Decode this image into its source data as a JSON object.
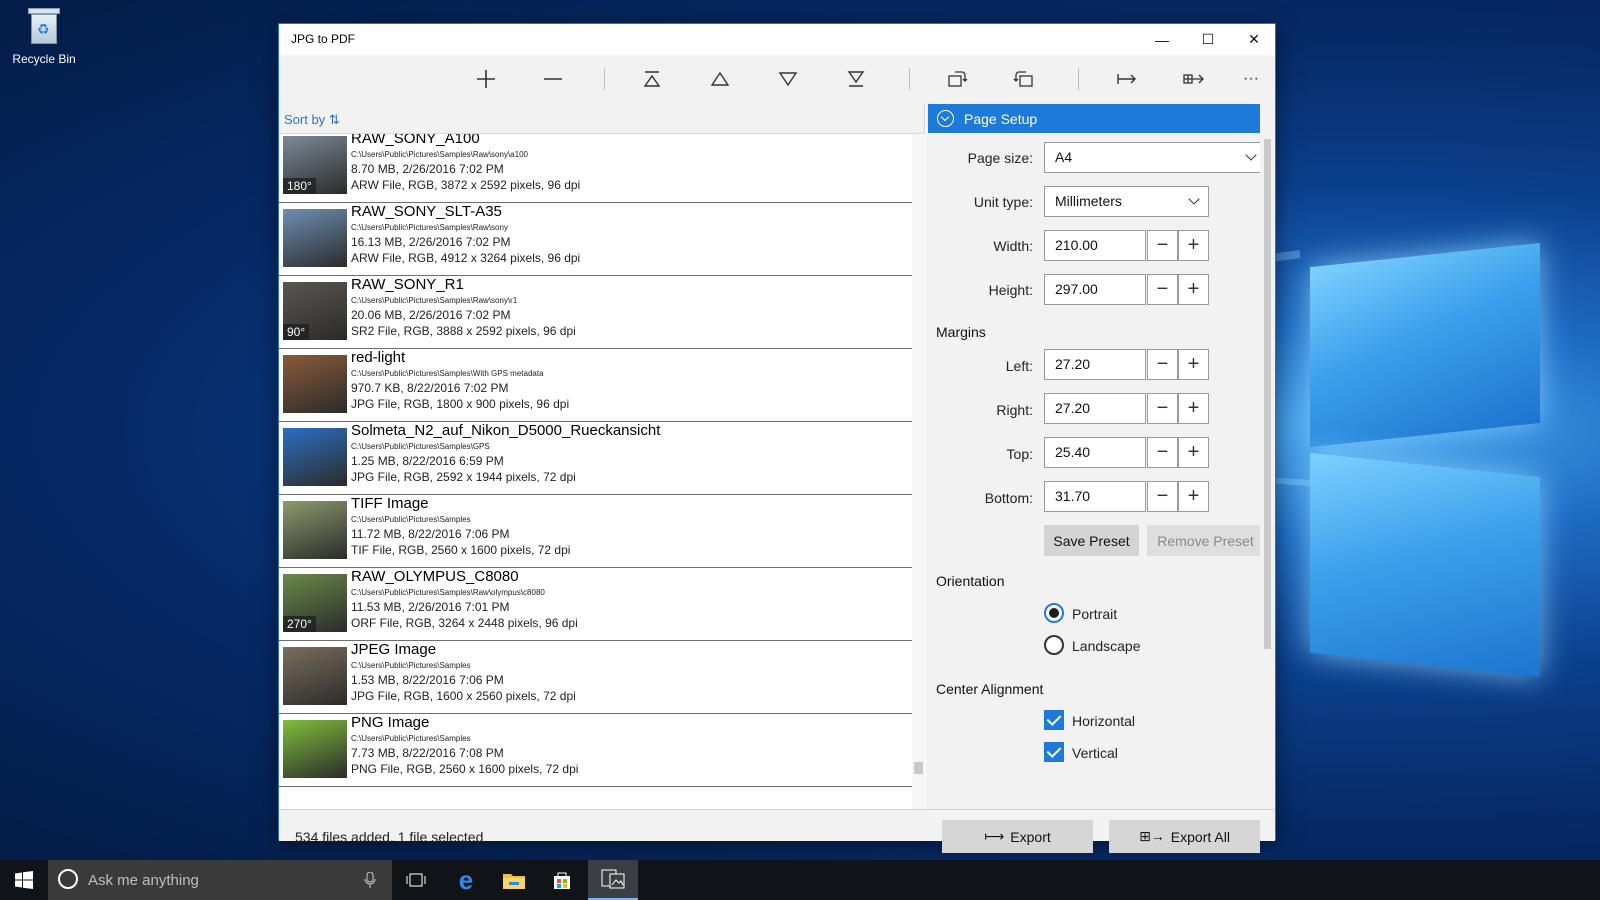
{
  "desktop": {
    "recycle_bin_label": "Recycle Bin"
  },
  "window": {
    "title": "JPG to PDF",
    "controls": {
      "minimize": "—",
      "maximize": "☐",
      "close": "✕"
    }
  },
  "toolbar": {
    "icons": [
      "add-icon",
      "remove-icon",
      "move-to-top-icon",
      "move-up-icon",
      "move-down-icon",
      "move-to-bottom-icon",
      "rotate-left-icon",
      "rotate-right-icon",
      "export-icon",
      "export-all-icon",
      "more-icon"
    ],
    "more_label": "···"
  },
  "list": {
    "sort_label": "Sort by",
    "items": [
      {
        "name": "RAW_SONY_A100",
        "path": "C:\\Users\\Public\\Pictures\\Samples\\Raw\\sony\\a100",
        "size": "8.70 MB, 2/26/2016 7:02 PM",
        "info": "ARW File, RGB, 3872 x 2592 pixels, 96 dpi",
        "rotation": "180°",
        "thumb": "#7c8a96"
      },
      {
        "name": "RAW_SONY_SLT-A35",
        "path": "C:\\Users\\Public\\Pictures\\Samples\\Raw\\sony",
        "size": "16.13 MB, 2/26/2016 7:02 PM",
        "info": "ARW File, RGB, 4912 x 3264 pixels, 96 dpi",
        "rotation": "",
        "thumb": "#6f8fb4"
      },
      {
        "name": "RAW_SONY_R1",
        "path": "C:\\Users\\Public\\Pictures\\Samples\\Raw\\sony\\r1",
        "size": "20.06 MB, 2/26/2016 7:02 PM",
        "info": "SR2 File, RGB, 3888 x 2592 pixels, 96 dpi",
        "rotation": "90°",
        "thumb": "#5b5550"
      },
      {
        "name": "red-light",
        "path": "C:\\Users\\Public\\Pictures\\Samples\\With GPS metadata",
        "size": "970.7 KB, 8/22/2016 7:02 PM",
        "info": "JPG File, RGB, 1800 x 900 pixels, 96 dpi",
        "rotation": "",
        "thumb": "#8a5a3a"
      },
      {
        "name": "Solmeta_N2_auf_Nikon_D5000_Rueckansicht",
        "path": "C:\\Users\\Public\\Pictures\\Samples\\GPS",
        "size": "1.25 MB, 8/22/2016 6:59 PM",
        "info": "JPG File, RGB, 2592 x 1944 pixels, 72 dpi",
        "rotation": "",
        "thumb": "#2b6fc0"
      },
      {
        "name": "TIFF Image",
        "path": "C:\\Users\\Public\\Pictures\\Samples",
        "size": "11.72 MB, 8/22/2016 7:06 PM",
        "info": "TIF File, RGB, 2560 x 1600 pixels, 72 dpi",
        "rotation": "",
        "thumb": "#8c9a6c"
      },
      {
        "name": "RAW_OLYMPUS_C8080",
        "path": "C:\\Users\\Public\\Pictures\\Samples\\Raw\\olympus\\c8080",
        "size": "11.53 MB, 2/26/2016 7:01 PM",
        "info": "ORF File, RGB, 3264 x 2448 pixels, 96 dpi",
        "rotation": "270°",
        "thumb": "#6a8a4a"
      },
      {
        "name": "JPEG Image",
        "path": "C:\\Users\\Public\\Pictures\\Samples",
        "size": "1.53 MB, 8/22/2016 7:06 PM",
        "info": "JPG File, RGB, 1600 x 2560 pixels, 72 dpi",
        "rotation": "",
        "thumb": "#7a6e5c"
      },
      {
        "name": "PNG Image",
        "path": "C:\\Users\\Public\\Pictures\\Samples",
        "size": "7.73 MB, 8/22/2016 7:08 PM",
        "info": "PNG File, RGB, 2560 x 1600 pixels, 72 dpi",
        "rotation": "",
        "thumb": "#7fbf3a"
      }
    ]
  },
  "page_setup": {
    "header": "Page Setup",
    "page_size_label": "Page size:",
    "page_size_value": "A4",
    "unit_type_label": "Unit type:",
    "unit_type_value": "Millimeters",
    "width_label": "Width:",
    "width_value": "210.00",
    "height_label": "Height:",
    "height_value": "297.00",
    "margins_label": "Margins",
    "left_label": "Left:",
    "left_value": "27.20",
    "right_label": "Right:",
    "right_value": "27.20",
    "top_label": "Top:",
    "top_value": "25.40",
    "bottom_label": "Bottom:",
    "bottom_value": "31.70",
    "save_preset": "Save Preset",
    "remove_preset": "Remove Preset",
    "orientation_label": "Orientation",
    "portrait": "Portrait",
    "landscape": "Landscape",
    "center_alignment_label": "Center Alignment",
    "horizontal": "Horizontal",
    "vertical": "Vertical"
  },
  "statusbar": {
    "status": "534 files added, 1 file selected",
    "export": "Export",
    "export_all": "Export All"
  },
  "taskbar": {
    "search_placeholder": "Ask me anything"
  },
  "colors": {
    "accent": "#1e7ad8",
    "link": "#2a73c8"
  }
}
